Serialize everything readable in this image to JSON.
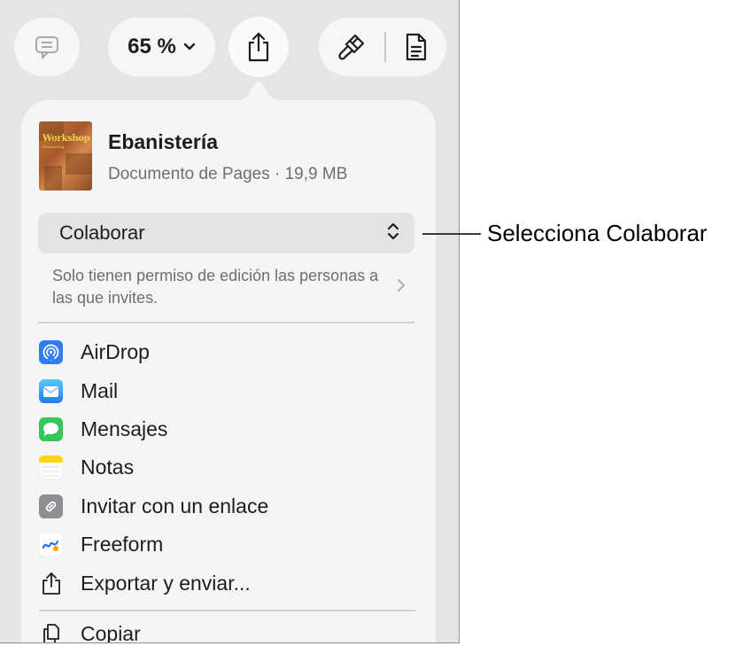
{
  "toolbar": {
    "zoom_value": "65 %"
  },
  "document": {
    "title": "Ebanistería",
    "subtitle": "Documento de Pages · 19,9 MB",
    "thumbnail_text": "Workshop",
    "thumbnail_subtext": "Woodworking"
  },
  "collaboration": {
    "selected_option": "Colaborar",
    "permission_text": "Solo tienen permiso de edición las personas a las que invites."
  },
  "menu": {
    "items": [
      {
        "label": "AirDrop",
        "icon": "airdrop-icon"
      },
      {
        "label": "Mail",
        "icon": "mail-icon"
      },
      {
        "label": "Mensajes",
        "icon": "messages-icon"
      },
      {
        "label": "Notas",
        "icon": "notes-icon"
      },
      {
        "label": "Invitar con un enlace",
        "icon": "link-icon"
      },
      {
        "label": "Freeform",
        "icon": "freeform-icon"
      },
      {
        "label": "Exportar y enviar...",
        "icon": "export-icon"
      },
      {
        "label": "Copiar",
        "icon": "copy-icon"
      }
    ]
  },
  "callout": {
    "text": "Selecciona Colaborar"
  },
  "colors": {
    "screen_bg": "#e5e5e7",
    "popover_bg": "#f5f5f6",
    "airdrop": "#2f7cf6",
    "messages": "#34c759",
    "notes": "#ffd60a"
  }
}
